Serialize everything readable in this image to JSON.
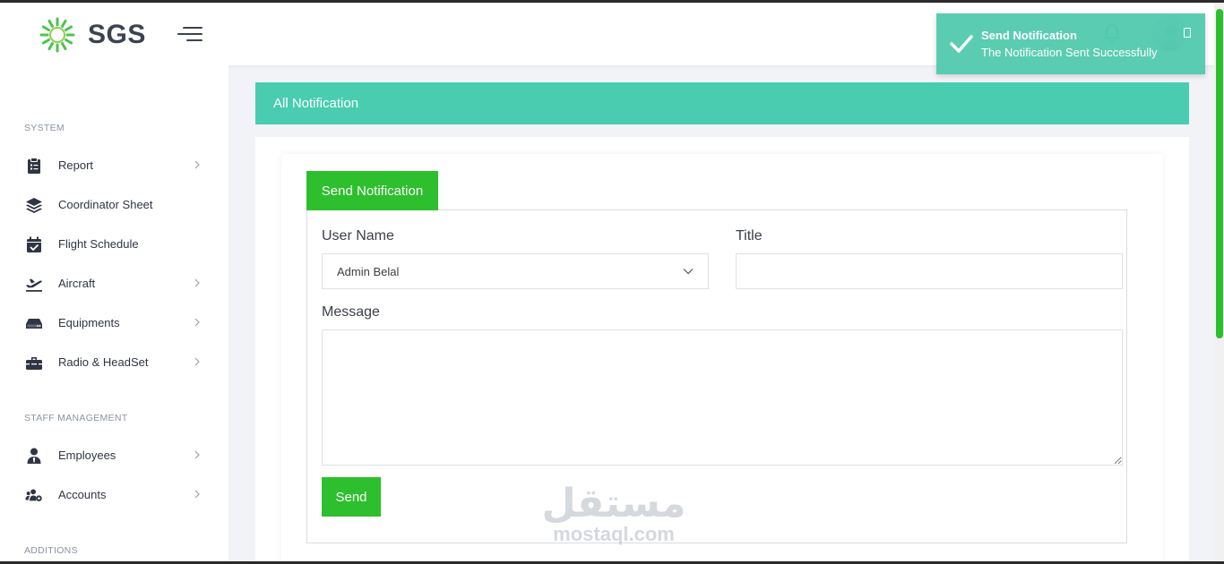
{
  "header": {
    "logo_text": "SGS"
  },
  "toast": {
    "title": "Send Notification",
    "message": "The Notification Sent Successfully"
  },
  "sidebar": {
    "sections": [
      {
        "title": "SYSTEM"
      },
      {
        "title": "STAFF MANAGEMENT"
      },
      {
        "title": "ADDITIONS"
      }
    ],
    "items": [
      {
        "label": "Report",
        "icon": "clipboard-icon",
        "has_submenu": true
      },
      {
        "label": "Coordinator Sheet",
        "icon": "layers-icon",
        "has_submenu": false
      },
      {
        "label": "Flight Schedule",
        "icon": "calendar-check-icon",
        "has_submenu": false
      },
      {
        "label": "Aircraft",
        "icon": "plane-icon",
        "has_submenu": true
      },
      {
        "label": "Equipments",
        "icon": "hdd-icon",
        "has_submenu": true
      },
      {
        "label": "Radio & HeadSet",
        "icon": "toolbox-icon",
        "has_submenu": true
      },
      {
        "label": "Employees",
        "icon": "user-tie-icon",
        "has_submenu": true
      },
      {
        "label": "Accounts",
        "icon": "users-cog-icon",
        "has_submenu": true
      }
    ]
  },
  "main": {
    "page_title": "All Notification",
    "tab_label": "Send Notification",
    "form": {
      "user_name_label": "User Name",
      "user_name_value": "Admin Belal",
      "title_label": "Title",
      "title_value": "",
      "message_label": "Message",
      "message_value": "",
      "send_label": "Send"
    }
  },
  "watermark": {
    "arabic": "مستقل",
    "latin": "mostaql.com"
  },
  "colors": {
    "accent_green": "#2dbf2d",
    "teal": "#49ccb0",
    "toast_bg": "#4ec9ad"
  }
}
